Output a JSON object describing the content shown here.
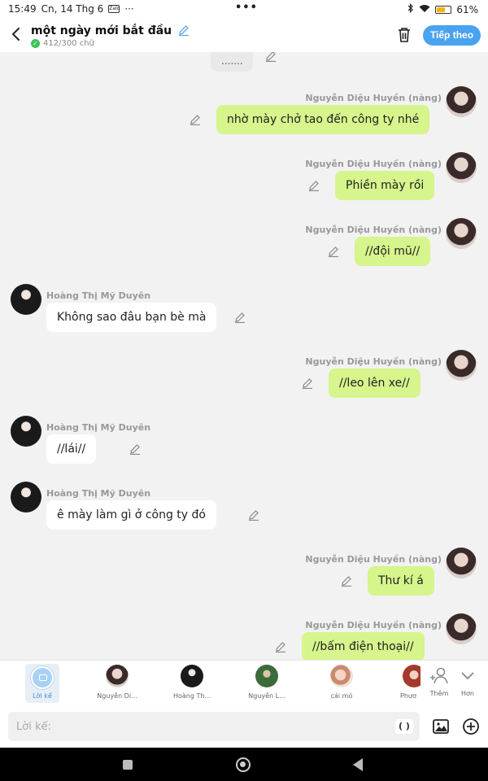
{
  "status": {
    "time": "15:49",
    "date": "Cn, 14 Thg 6",
    "app_badge": "Zalo",
    "battery": "61",
    "battery_level": 0.61
  },
  "header": {
    "title": "một ngày mới bắt đầu",
    "word_count": "412/300 chữ",
    "follow_label": "Tiếp theo"
  },
  "chat": {
    "partial_text": ".......",
    "messages": [
      {
        "side": "right",
        "name": "Nguyễn Diệu Huyền (nàng)",
        "text": "nhờ mày chở tao đến công ty nhé"
      },
      {
        "side": "right",
        "name": "Nguyễn Diệu Huyền (nàng)",
        "text": "Phiền mày rồi"
      },
      {
        "side": "right",
        "name": "Nguyễn Diệu Huyền (nàng)",
        "text": "//đội mũ//"
      },
      {
        "side": "left",
        "name": "Hoàng Thị Mỹ Duyên",
        "text": "Không sao đâu bạn bè mà"
      },
      {
        "side": "right",
        "name": "Nguyễn Diệu Huyền (nàng)",
        "text": "//leo lên xe//"
      },
      {
        "side": "left",
        "name": "Hoàng Thị Mỹ Duyên",
        "text": "//lái//"
      },
      {
        "side": "left",
        "name": "Hoàng Thị Mỹ Duyên",
        "text": "ê mày làm gì ở công ty đó"
      },
      {
        "side": "right",
        "name": "Nguyễn Diệu Huyền (nàng)",
        "text": "Thư kí á"
      },
      {
        "side": "right",
        "name": "Nguyễn Diệu Huyền (nàng)",
        "text": "//bấm điện thoại//"
      }
    ]
  },
  "characters": {
    "narrator_label": "Lời kể",
    "items": [
      {
        "label": "Nguyễn Di..."
      },
      {
        "label": "Hoàng Th..."
      },
      {
        "label": "Nguyễn L..."
      },
      {
        "label": "cái mỏ"
      },
      {
        "label": "Phươ"
      }
    ],
    "add_label": "Thêm",
    "more_label": "Hơn"
  },
  "input": {
    "placeholder": "Lời kể:",
    "paren_label": "( )"
  }
}
